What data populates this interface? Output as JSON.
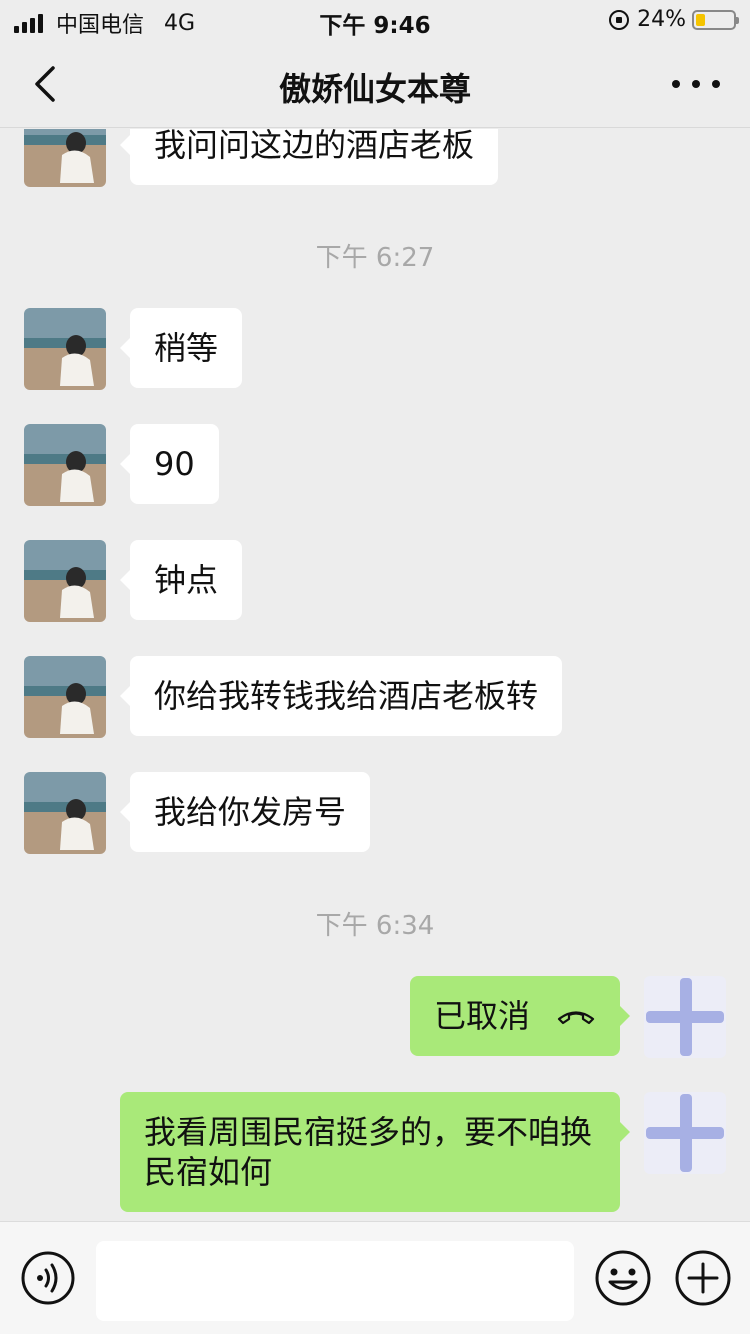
{
  "status_bar": {
    "carrier": "中国电信",
    "network": "4G",
    "time": "下午 9:46",
    "battery_percent_label": "24%",
    "battery_level": 0.24
  },
  "nav": {
    "title": "傲娇仙女本尊"
  },
  "messages": [
    {
      "type": "in",
      "text": "我问问这边的酒店老板"
    },
    {
      "type": "time",
      "text": "下午 6:27"
    },
    {
      "type": "in",
      "text": "稍等"
    },
    {
      "type": "in",
      "text": "90"
    },
    {
      "type": "in",
      "text": "钟点"
    },
    {
      "type": "in",
      "text": "你给我转钱我给酒店老板转"
    },
    {
      "type": "in",
      "text": "我给你发房号"
    },
    {
      "type": "time",
      "text": "下午 6:34"
    },
    {
      "type": "out",
      "text": "已取消",
      "icon": "phone-hangup-icon"
    },
    {
      "type": "out",
      "text": "我看周围民宿挺多的，要不咱换民宿如何"
    }
  ],
  "input": {
    "placeholder": ""
  },
  "colors": {
    "background": "#ededed",
    "outgoing_bubble": "#a9e979",
    "incoming_bubble": "#ffffff",
    "timestamp": "#a8a8a8",
    "battery": "#f5c400"
  }
}
